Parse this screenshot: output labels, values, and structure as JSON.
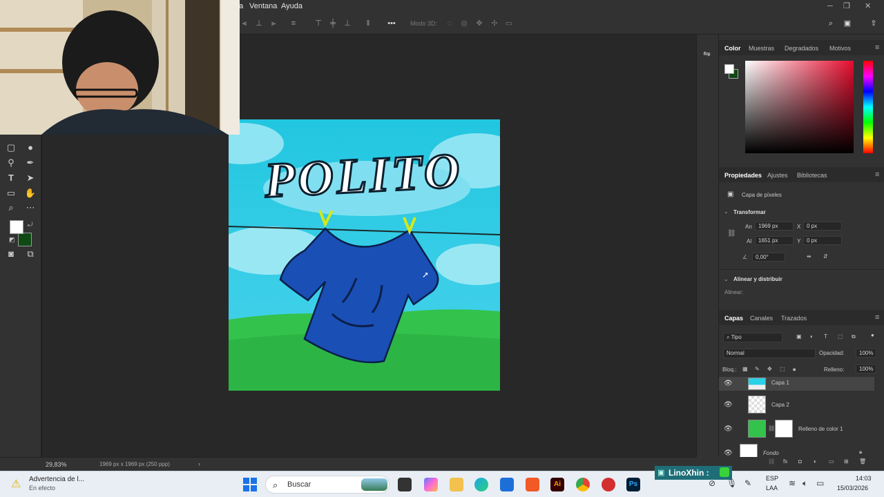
{
  "menubar": {
    "partial_menu": "a",
    "items": [
      "Ventana",
      "Ayuda"
    ]
  },
  "options_bar": {
    "mode_3d": "Modo 3D:"
  },
  "canvas": {
    "title_text": "POLITO",
    "sky_color": "#4fd0ea",
    "grass_color": "#33c24b",
    "shirt_color": "#1a4fb5"
  },
  "status": {
    "zoom": "29,83%",
    "doc_info": "1969 px x 1969 px (250 ppp)"
  },
  "color_panel": {
    "tabs": [
      "Color",
      "Muestras",
      "Degradados",
      "Motivos"
    ],
    "foreground": "#ffffff",
    "background": "#0f4a14"
  },
  "properties_panel": {
    "tabs": [
      "Propiedades",
      "Ajustes",
      "Bibliotecas"
    ],
    "layer_type": "Capa de píxeles",
    "transform_title": "Transformar",
    "width_label": "An",
    "width_value": "1969 px",
    "height_label": "Al",
    "height_value": "1651 px",
    "x_label": "X",
    "x_value": "0 px",
    "y_label": "Y",
    "y_value": "0 px",
    "angle_value": "0,00°",
    "align_title": "Alinear y distribuir",
    "align_label": "Alinear:"
  },
  "layers_panel": {
    "tabs": [
      "Capas",
      "Canales",
      "Trazados"
    ],
    "filter_kind": "Tipo",
    "blend_mode": "Normal",
    "opacity_label": "Opacidad:",
    "opacity_value": "100%",
    "lock_label": "Bloq.:",
    "fill_label": "Relleno:",
    "fill_value": "100%",
    "layers": [
      {
        "name": "Capa 1"
      },
      {
        "name": "Capa 2"
      },
      {
        "name": "Relleno de color 1"
      },
      {
        "name": "Fondo"
      }
    ]
  },
  "taskbar": {
    "notification_title": "Advertencia de l...",
    "notification_sub": "En efecto",
    "search_label": "Buscar",
    "streamer_name": "LinoXhin :",
    "lang_top": "ESP",
    "lang_bottom": "LAA",
    "time": "14:03",
    "date": "15/03/2026"
  }
}
